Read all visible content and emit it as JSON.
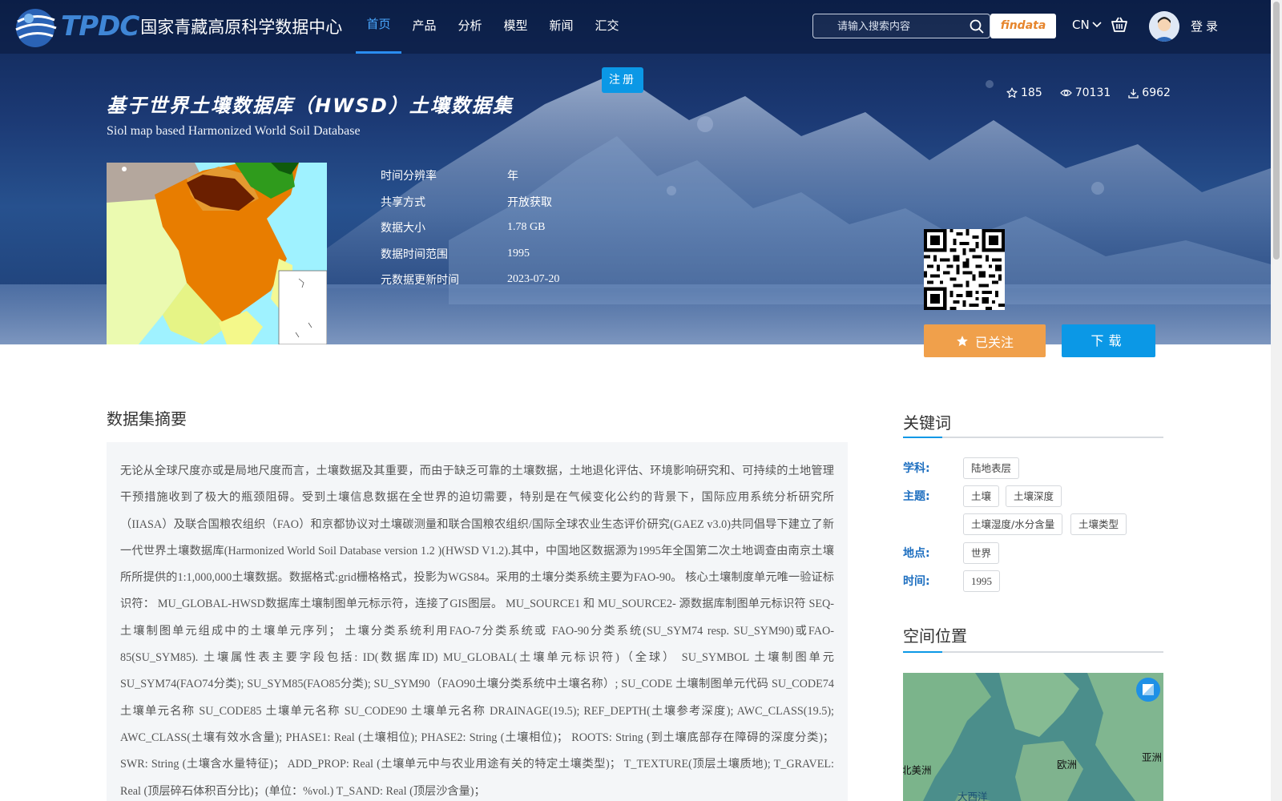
{
  "header": {
    "logo_text": "TPDC",
    "logo_name": "国家青藏高原科学数据中心",
    "nav": [
      "首页",
      "产品",
      "分析",
      "模型",
      "新闻",
      "汇交"
    ],
    "search_placeholder": "请输入搜索内容",
    "findata_label": "findata",
    "lang_label": "CN",
    "login_label": "登录",
    "register_label": "注册"
  },
  "dataset": {
    "title_cn": "基于世界土壤数据库（HWSD）土壤数据集",
    "title_en": "Siol map based Harmonized World Soil Database",
    "stats": {
      "favorites": "185",
      "views": "70131",
      "downloads": "6962"
    },
    "meta": [
      {
        "key": "时间分辨率",
        "value": "年"
      },
      {
        "key": "共享方式",
        "value": "开放获取"
      },
      {
        "key": "数据大小",
        "value": "1.78 GB"
      },
      {
        "key": "数据时间范围",
        "value": "1995"
      },
      {
        "key": "元数据更新时间",
        "value": "2023-07-20"
      }
    ],
    "follow_label": "已关注",
    "download_label": "下载"
  },
  "summary": {
    "title": "数据集摘要",
    "text": "无论从全球尺度亦或是局地尺度而言，土壤数据及其重要，而由于缺乏可靠的土壤数据，土地退化评估、环境影响研究和、可持续的土地管理干预措施收到了极大的瓶颈阻碍。受到土壤信息数据在全世界的迫切需要，特别是在气候变化公约的背景下，国际应用系统分析研究所（IIASA）及联合国粮农组织（FAO）和京都协议对土壤碳测量和联合国粮农组织/国际全球农业生态评价研究(GAEZ v3.0)共同倡导下建立了新一代世界土壤数据库(Harmonized World Soil Database version 1.2 )(HWSD V1.2).其中，中国地区数据源为1995年全国第二次土地调查由南京土壤所所提供的1:1,000,000土壤数据。数据格式:grid栅格格式，投影为WGS84。采用的土壤分类系统主要为FAO-90。 核心土壤制度单元唯一验证标识符： MU_GLOBAL-HWSD数据库土壤制图单元标示符，连接了GIS图层。 MU_SOURCE1 和 MU_SOURCE2- 源数据库制图单元标识符 SEQ-土壤制图单元组成中的土壤单元序列； 土壤分类系统利用FAO-7分类系统或 FAO-90分类系统(SU_SYM74 resp. SU_SYM90)或FAO-85(SU_SYM85). 土壤属性表主要字段包括: ID(数据库ID) MU_GLOBAL(土壤单元标识符)（全球） SU_SYMBOL 土壤制图单元 SU_SYM74(FAO74分类); SU_SYM85(FAO85分类); SU_SYM90（FAO90土壤分类系统中土壤名称）; SU_CODE 土壤制图单元代码 SU_CODE74 土壤单元名称 SU_CODE85 土壤单元名称 SU_CODE90 土壤单元名称 DRAINAGE(19.5); REF_DEPTH(土壤参考深度); AWC_CLASS(19.5); AWC_CLASS(土壤有效水含量); PHASE1: Real (土壤相位); PHASE2: String (土壤相位)； ROOTS: String (到土壤底部存在障碍的深度分类)； SWR: String (土壤含水量特征)； ADD_PROP: Real (土壤单元中与农业用途有关的特定土壤类型)； T_TEXTURE(顶层土壤质地); T_GRAVEL: Real (顶层碎石体积百分比)；(单位：%vol.) T_SAND: Real (顶层沙含量)；"
  },
  "keywords": {
    "title": "关键词",
    "groups": [
      {
        "label": "学科:",
        "tags": [
          "陆地表层"
        ]
      },
      {
        "label": "主题:",
        "tags": [
          "土壤",
          "土壤深度",
          "土壤湿度/水分含量",
          "土壤类型"
        ]
      },
      {
        "label": "地点:",
        "tags": [
          "世界"
        ]
      },
      {
        "label": "时间:",
        "tags": [
          "1995"
        ]
      }
    ]
  },
  "location": {
    "title": "空间位置",
    "map_labels": [
      "北美洲",
      "欧洲",
      "亚洲",
      "大西洋"
    ]
  },
  "colors": {
    "accent_blue": "#0b98e6",
    "follow_orange": "#f0a04b",
    "keyword_label_blue": "#1e6fc0"
  }
}
